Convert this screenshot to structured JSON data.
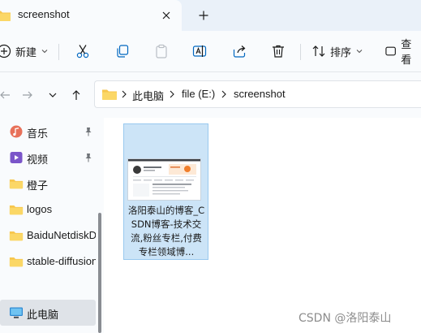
{
  "tab": {
    "title": "screenshot"
  },
  "commands": {
    "new_label": "新建",
    "sort_label": "排序",
    "view_label": "查看"
  },
  "address": {
    "crumbs": [
      "此电脑",
      "file (E:)",
      "screenshot"
    ]
  },
  "nav": {
    "items": [
      {
        "label": "音乐",
        "icon": "music-icon",
        "pinned": true
      },
      {
        "label": "视频",
        "icon": "video-icon",
        "pinned": true
      },
      {
        "label": "橙子",
        "icon": "folder-icon",
        "pinned": false
      },
      {
        "label": "logos",
        "icon": "folder-icon",
        "pinned": false
      },
      {
        "label": "BaiduNetdiskDownload",
        "icon": "folder-icon",
        "pinned": false
      },
      {
        "label": "stable-diffusion",
        "icon": "folder-icon",
        "pinned": false
      },
      {
        "label": "此电脑",
        "icon": "computer-icon",
        "pinned": false,
        "selected": true
      }
    ]
  },
  "content": {
    "file": {
      "name": "洛阳泰山的博客_CSDN博客-技术交流,粉丝专栏,付费专栏领域博..."
    }
  },
  "watermark": "CSDN @洛阳泰山",
  "colors": {
    "accent": "#0067c0",
    "selection": "#cce4f7",
    "folder": "#f7c64d"
  }
}
